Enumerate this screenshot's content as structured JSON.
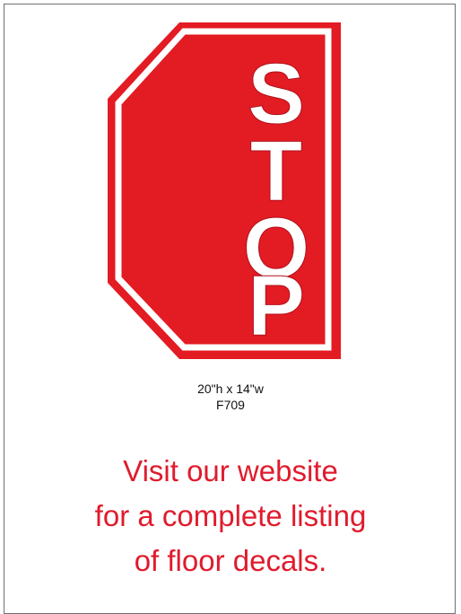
{
  "sign": {
    "letters": [
      "S",
      "T",
      "O",
      "P"
    ],
    "colors": {
      "red": "#e31b23",
      "border": "#ffffff"
    }
  },
  "product": {
    "size": "20\"h x 14\"w",
    "code": "F709"
  },
  "promo": {
    "line1": "Visit our website",
    "line2": "for a complete listing",
    "line3": "of floor decals."
  }
}
